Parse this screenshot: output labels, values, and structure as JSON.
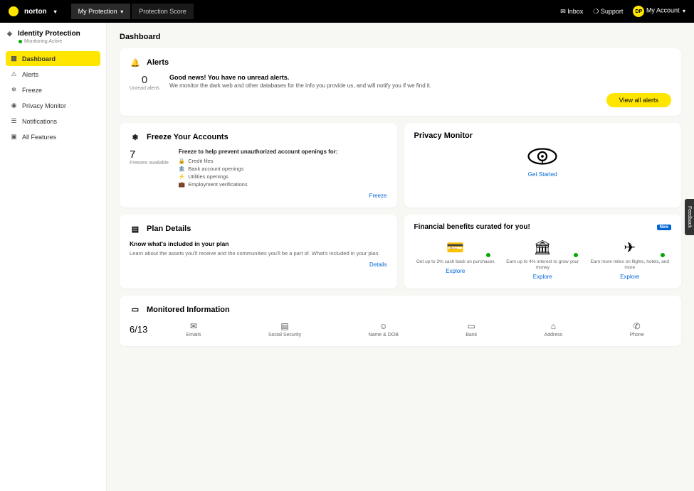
{
  "header": {
    "brand": "norton",
    "tab1": "My Protection",
    "tab2": "Protection Score",
    "inbox": "Inbox",
    "support": "Support",
    "account": "My Account"
  },
  "sidebar": {
    "title": "Identity Protection",
    "subtitle": "Monitoring Active",
    "items": [
      {
        "icon": "▦",
        "label": "Dashboard"
      },
      {
        "icon": "⚠",
        "label": "Alerts"
      },
      {
        "icon": "❄",
        "label": "Freeze"
      },
      {
        "icon": "◉",
        "label": "Privacy Monitor"
      },
      {
        "icon": "☰",
        "label": "Notifications"
      },
      {
        "icon": "▣",
        "label": "All Features"
      }
    ]
  },
  "page": {
    "title": "Dashboard"
  },
  "alerts": {
    "title": "Alerts",
    "count": "0",
    "count_label": "Unread alerts",
    "headline": "Good news! You have no unread alerts.",
    "desc": "We monitor the dark web and other databases for the info you provide us, and will notify you if we find it.",
    "button": "View all alerts"
  },
  "freeze": {
    "title": "Freeze Your Accounts",
    "count": "7",
    "count_label": "Freezes available",
    "headline": "Freeze to help prevent unauthorized account openings for:",
    "items": [
      "Credit files",
      "Bank account openings",
      "Utilities openings",
      "Employment verifications"
    ],
    "link": "Freeze"
  },
  "privacy": {
    "title": "Privacy Monitor",
    "link": "Get Started"
  },
  "plan": {
    "title": "Plan Details",
    "head": "Know what's included in your plan",
    "desc": "Learn about the assets you'll receive and the communities you'll be a part of. What's included in your plan.",
    "link": "Details"
  },
  "financial": {
    "title": "Financial benefits curated for you!",
    "badge": "New",
    "items": [
      {
        "caption": "Get up to 3% cash back on purchases",
        "link": "Explore"
      },
      {
        "caption": "Earn up to 4% interest to grow your money",
        "link": "Explore"
      },
      {
        "caption": "Earn more miles on flights, hotels, and more",
        "link": "Explore"
      }
    ]
  },
  "monitored": {
    "title": "Monitored Information",
    "count": "6/13",
    "items": [
      {
        "icon": "✉",
        "label": "Emails"
      },
      {
        "icon": "▤",
        "label": "Social Security"
      },
      {
        "icon": "☺",
        "label": "Name & DOB"
      },
      {
        "icon": "▭",
        "label": "Bank"
      },
      {
        "icon": "⌂",
        "label": "Address"
      },
      {
        "icon": "✆",
        "label": "Phone"
      }
    ]
  },
  "feedback": "Feedback"
}
